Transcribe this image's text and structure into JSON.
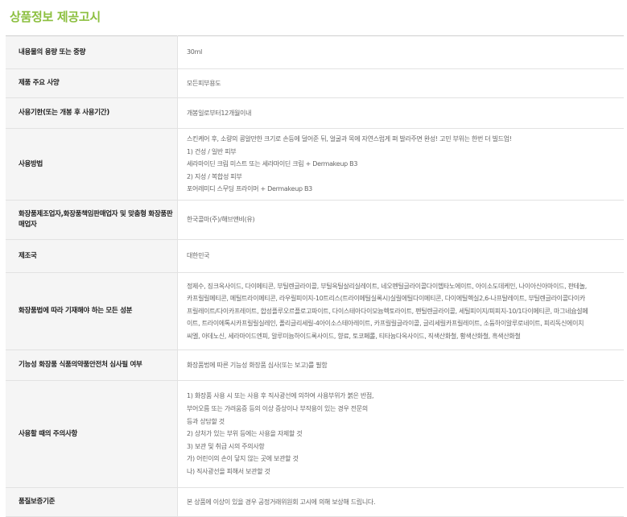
{
  "title": "상품정보 제공고시",
  "rows": [
    {
      "label": "내용물의 용량 또는 중량",
      "lines": [
        "30ml"
      ]
    },
    {
      "label": "제품 주요 사양",
      "lines": [
        "모든피부용도"
      ]
    },
    {
      "label": "사용기한(또는 개봉 후 사용기간)",
      "lines": [
        "개봉일로부터12개월이내"
      ]
    },
    {
      "label": "사용방법",
      "lines": [
        "스킨케어 후, 소량의 콩알만한 크기로 손등에 덜어준 뒤, 얼굴과 목에 자연스럽게 펴 발라주면 완성! 고민 부위는 한번 더 빌드업!",
        "1) 건성 / 일반 피부",
        "세라마이딘 크림 미스트 또는 세라마이딘 크림 + Dermakeup B3",
        "2) 지성 / 복합성 피부",
        "포어레미디 스무딩 프라이머 + Dermakeup B3"
      ]
    },
    {
      "label": "화장품제조업자,화장품책임판매업자 및 맞춤형 화장품판매업자",
      "lines": [
        "한국콜마(주)/해브앤비(유)"
      ]
    },
    {
      "label": "제조국",
      "lines": [
        "대한민국"
      ]
    },
    {
      "label": "화장품법에 따라 기재해야 하는 모든 성분",
      "lines": [
        "정제수, 징크옥사이드, 다이메티콘, 부틸렌글라이콜, 부틸옥틸살리실레이트, 네오펜틸글라이콜다이헵타노에이트, 아이소도데케인, 나이아신아마이드, 판테놀,",
        "카프릴릴메티콘, 메틸트라이메티콘, 라우릴피이지-10트리스(트라이메틸실록시)실릴에틸다이메티콘, 다이에틸헥실2,6-나프탈레이트, 부틸렌글라이콜다이카",
        "프릴레이트/다이카프레이트, 합성플루오르플로고파이트, 다이스테아다이모늄헥토라이트, 펜틸렌글라이콜, 세틸피이지/피피지-10/1다이메티콘, 마그네슘설페",
        "이트, 트라이에톡시카프릴릴실레인, 폴리글리세릴-4아이소스테아레이트, 카프릴릴글라이콜, 글리세릴카프릴레이트, 소듐하이알루로네이트, 피리독신에이치",
        "씨엘, 아데노신, 세라마이드엔피, 알루미늄하이드록사이드, 향료, 토코페롤, 티타늄다옥사이드, 직색산화철, 황색산화철, 흑색산화철"
      ]
    },
    {
      "label": "기능성 화장품 식품의약품안전처 심사필 여부",
      "lines": [
        "화장품법에 따른 기능성 화장품 심사(또는 보고)를 필함"
      ]
    },
    {
      "label": "사용할 때의 주의사항",
      "lines": [
        "1) 화장품 사용 시 또는 사용 후 직사광선에 의하여 사용부위가 붉은 반점,",
        "부어오름 또는 가려움증 등의 이상 증상이나 부작용이 있는 경우 전문의",
        "등과 상담할 것",
        "2) 상처가 있는 부위 등에는 사용을 자제할 것",
        "3) 보관 및 취급 시의 주의사항",
        "가) 어린이의 손이 닿지 않는 곳에 보관할 것",
        "나) 직사광선을 피해서 보관할 것"
      ]
    },
    {
      "label": "품질보증기준",
      "lines": [
        "본 상품에 이상이 있을 경우 공정거래위원회 고시에 의해 보상해 드립니다."
      ]
    }
  ]
}
